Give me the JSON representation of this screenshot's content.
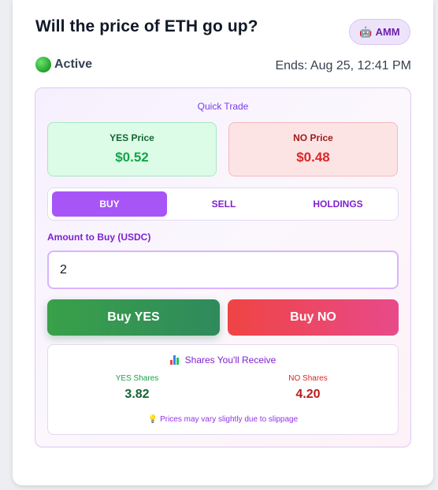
{
  "market": {
    "question": "Will the price of ETH go up?",
    "badge_label": "AMM",
    "badge_icon": "robot-icon",
    "status": "Active",
    "status_color": "#22c55e",
    "ends": "Ends: Aug 25, 12:41 PM"
  },
  "quick_trade": {
    "title": "Quick Trade",
    "yes_price_label": "YES Price",
    "yes_price": "$0.52",
    "no_price_label": "NO Price",
    "no_price": "$0.48",
    "tabs": [
      {
        "label": "BUY",
        "active": true
      },
      {
        "label": "SELL",
        "active": false
      },
      {
        "label": "HOLDINGS",
        "active": false
      }
    ],
    "amount_label": "Amount to Buy (USDC)",
    "amount_value": "2",
    "buy_yes_label": "Buy YES",
    "buy_no_label": "Buy NO"
  },
  "receive": {
    "title": "Shares You'll Receive",
    "yes_label": "YES Shares",
    "yes_value": "3.82",
    "no_label": "NO Shares",
    "no_value": "4.20",
    "note": "Prices may vary slightly due to slippage"
  },
  "colors": {
    "accent": "#a855f7",
    "yes": "#16a34a",
    "no": "#dc2626"
  }
}
